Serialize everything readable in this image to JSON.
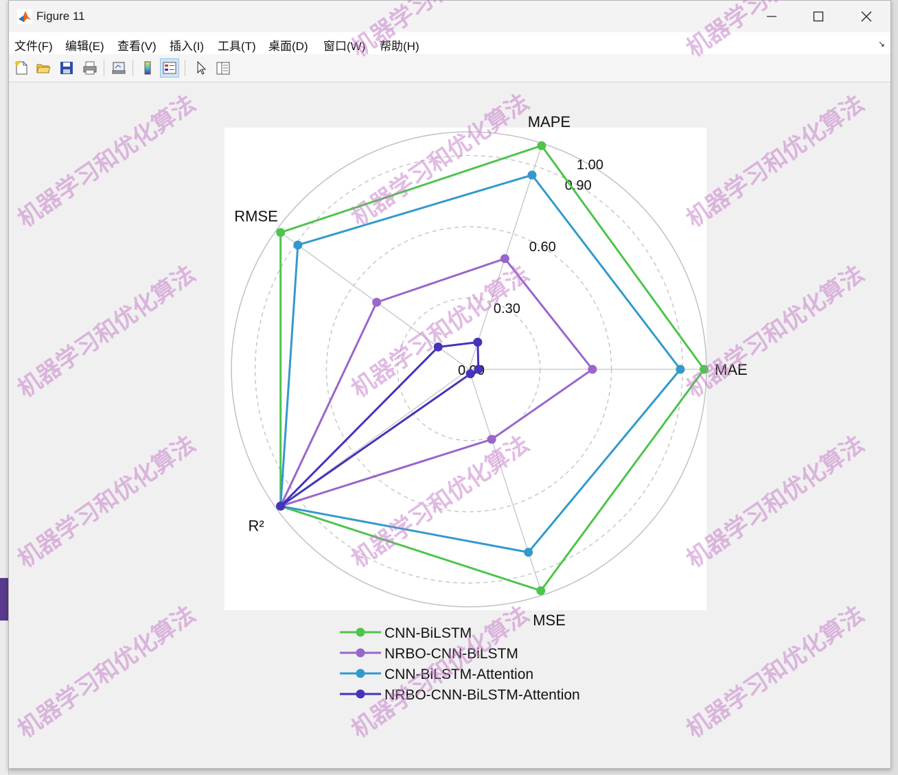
{
  "window": {
    "title": "Figure 11",
    "controls": {
      "minimize": "minimize",
      "maximize": "maximize",
      "close": "close"
    }
  },
  "menu": {
    "items": [
      "文件(F)",
      "编辑(E)",
      "查看(V)",
      "插入(I)",
      "工具(T)",
      "桌面(D)",
      "窗口(W)",
      "帮助(H)"
    ]
  },
  "toolbar": {
    "buttons": [
      "new-figure-icon",
      "open-file-icon",
      "save-icon",
      "print-icon",
      "link-plot-icon",
      "colorbar-icon",
      "legend-icon",
      "pointer-icon",
      "property-editor-icon"
    ]
  },
  "watermark_text": "机器学习和优化算法",
  "chart_data": {
    "type": "radar",
    "axes": [
      "MAE",
      "MAPE",
      "RMSE",
      "R²",
      "MSE"
    ],
    "rlim": [
      0,
      1.0
    ],
    "radial_ticks": [
      0.0,
      0.3,
      0.6,
      0.9,
      1.0
    ],
    "radial_tick_labels": [
      "0.00",
      "0.30",
      "0.60",
      "0.90",
      "1.00"
    ],
    "grid": true,
    "legend_position": "bottom",
    "series": [
      {
        "name": "CNN-BiLSTM",
        "color": "#4dc44d",
        "values": [
          0.99,
          0.99,
          0.98,
          0.98,
          0.98
        ]
      },
      {
        "name": "NRBO-CNN-BiLSTM",
        "color": "#9966cc",
        "values": [
          0.52,
          0.49,
          0.48,
          0.98,
          0.31
        ]
      },
      {
        "name": "CNN-BiLSTM-Attention",
        "color": "#3399cc",
        "values": [
          0.89,
          0.86,
          0.89,
          0.98,
          0.81
        ]
      },
      {
        "name": "NRBO-CNN-BiLSTM-Attention",
        "color": "#4433bb",
        "values": [
          0.04,
          0.12,
          0.16,
          0.98,
          0.02
        ]
      }
    ]
  }
}
